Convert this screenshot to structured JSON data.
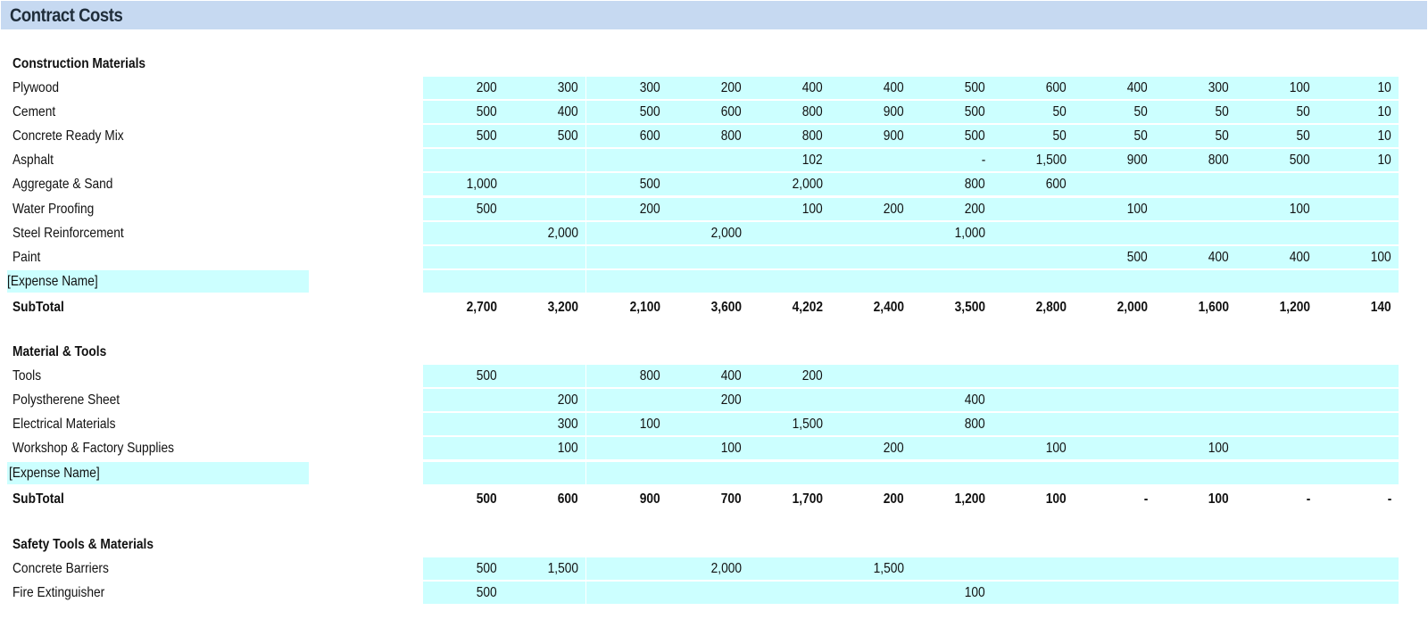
{
  "title": "Contract Costs",
  "sections": [
    {
      "heading": "Construction Materials",
      "rows": [
        {
          "label": "Plywood",
          "values": [
            "200",
            "300",
            "300",
            "200",
            "400",
            "400",
            "500",
            "600",
            "400",
            "300",
            "100",
            "10"
          ]
        },
        {
          "label": "Cement",
          "values": [
            "500",
            "400",
            "500",
            "600",
            "800",
            "900",
            "500",
            "50",
            "50",
            "50",
            "50",
            "10"
          ]
        },
        {
          "label": "Concrete Ready Mix",
          "values": [
            "500",
            "500",
            "600",
            "800",
            "800",
            "900",
            "500",
            "50",
            "50",
            "50",
            "50",
            "10"
          ]
        },
        {
          "label": "Asphalt",
          "values": [
            "",
            "",
            "",
            "",
            "102",
            "",
            "-",
            "1,500",
            "900",
            "800",
            "500",
            "10"
          ]
        },
        {
          "label": "Aggregate & Sand",
          "values": [
            "1,000",
            "",
            "500",
            "",
            "2,000",
            "",
            "800",
            "600",
            "",
            "",
            "",
            ""
          ]
        },
        {
          "label": "Water Proofing",
          "values": [
            "500",
            "",
            "200",
            "",
            "100",
            "200",
            "200",
            "",
            "100",
            "",
            "100",
            ""
          ]
        },
        {
          "label": "Steel Reinforcement",
          "values": [
            "",
            "2,000",
            "",
            "2,000",
            "",
            "",
            "1,000",
            "",
            "",
            "",
            "",
            ""
          ]
        },
        {
          "label": "Paint",
          "values": [
            "",
            "",
            "",
            "",
            "",
            "",
            "",
            "",
            "500",
            "400",
            "400",
            "100"
          ]
        },
        {
          "label": "[Expense Name]",
          "placeholder": true,
          "values": [
            "",
            "",
            "",
            "",
            "",
            "",
            "",
            "",
            "",
            "",
            "",
            ""
          ]
        }
      ],
      "subtotal_label": "SubTotal",
      "subtotal": [
        "2,700",
        "3,200",
        "2,100",
        "3,600",
        "4,202",
        "2,400",
        "3,500",
        "2,800",
        "2,000",
        "1,600",
        "1,200",
        "140"
      ]
    },
    {
      "heading": "Material & Tools",
      "rows": [
        {
          "label": "Tools",
          "values": [
            "500",
            "",
            "800",
            "400",
            "200",
            "",
            "",
            "",
            "",
            "",
            "",
            ""
          ]
        },
        {
          "label": "Polysthere ne Sheet",
          "values": [
            "",
            "200",
            "",
            "200",
            "",
            "",
            "400",
            "",
            "",
            "",
            "",
            ""
          ]
        },
        {
          "label": "Electrical Materials",
          "values": [
            "",
            "300",
            "100",
            "",
            "1,500",
            "",
            "800",
            "",
            "",
            "",
            "",
            ""
          ]
        },
        {
          "label": "Workshop & Factory Supplies",
          "values": [
            "",
            "100",
            "",
            "100",
            "",
            "200",
            "",
            "100",
            "",
            "100",
            "",
            ""
          ]
        },
        {
          "label": "[Expense Name]",
          "placeholder": true,
          "values": [
            "",
            "",
            "",
            "",
            "",
            "",
            "",
            "",
            "",
            "",
            "",
            ""
          ]
        }
      ],
      "subtotal_label": "SubTotal",
      "subtotal": [
        "500",
        "600",
        "900",
        "700",
        "1,700",
        "200",
        "1,200",
        "100",
        "-",
        "100",
        "-",
        "-"
      ]
    },
    {
      "heading": "Safety Tools & Materials",
      "rows": [
        {
          "label": "Concrete Barriers",
          "values": [
            "500",
            "1,500",
            "",
            "2,000",
            "",
            "1,500",
            "",
            "",
            "",
            "",
            "",
            ""
          ]
        },
        {
          "label": "Fire Extinguisher",
          "values": [
            "500",
            "",
            "",
            "",
            "",
            "",
            "100",
            "",
            "",
            "",
            "",
            ""
          ]
        }
      ]
    }
  ],
  "colors": {
    "title_bar": "#c6d9f1",
    "input_cell": "#ccffff"
  }
}
